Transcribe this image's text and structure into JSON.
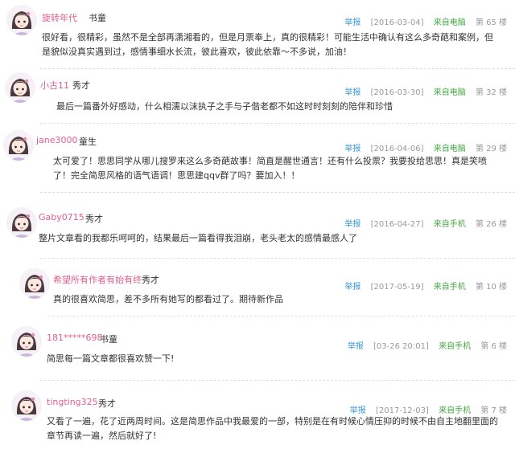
{
  "labels": {
    "report": "举报"
  },
  "comments": [
    {
      "user": "旋转年代",
      "rank": "书童",
      "date": "[2016-03-04]",
      "source": "来自电脑",
      "floor": "第 65 楼",
      "content": "很好看，很精彩，虽然不是全部再潇湘看的，但是月票奉上，真的很精彩！可能生活中确认有这么多奇葩和案例，但是貌似没真实遇到过，感情事细水长流，彼此喜欢，彼此依靠～不多说，加油！"
    },
    {
      "user": "小古11",
      "rank": "秀才",
      "date": "[2016-03-30]",
      "source": "来自电脑",
      "floor": "第 32 楼",
      "content": "最后一篇番外好感动，什么相濡以沫执子之手与子偕老都不如这时时刻刻的陪伴和珍惜"
    },
    {
      "user": "jane3000",
      "rank": "童生",
      "date": "[2016-04-06]",
      "source": "来自电脑",
      "floor": "第 29 楼",
      "content": "太可爱了！思思同学从哪儿搜罗来这么多奇葩故事！简直是醒世通言！还有什么投票？我要投给思思！真是笑喷了！完全简思风格的语气语调！思思建qqv群了吗？要加入！！"
    },
    {
      "user": "Gaby0715",
      "rank": "秀才",
      "date": "[2016-04-27]",
      "source": "来自手机",
      "floor": "第 26 楼",
      "content": "整片文章看的我都乐呵呵的，结果最后一篇看得我泪崩，老头老太的感情最感人了"
    },
    {
      "user": "希望所有作者有始有终",
      "rank": "秀才",
      "date": "[2017-05-19]",
      "source": "来自手机",
      "floor": "第 10 楼",
      "content": "真的很喜欢简思，差不多所有她写的都看过了。期待新作品"
    },
    {
      "user": "181*****698",
      "rank": "书童",
      "date": "[03-26 20:01]",
      "source": "来自手机",
      "floor": "第 6 楼",
      "content": "简思每一篇文章都很喜欢赞一下!"
    },
    {
      "user": "tingting325",
      "rank": "秀才",
      "date": "[2017-12-03]",
      "source": "来自手机",
      "floor": "第 7 楼",
      "content": "又看了一遍，花了近两周时间。这是简思作品中我最爱的一部，特别是在有时候心情压抑的时候不由自主地翻里面的章节再读一遍，然后就好了!"
    }
  ]
}
